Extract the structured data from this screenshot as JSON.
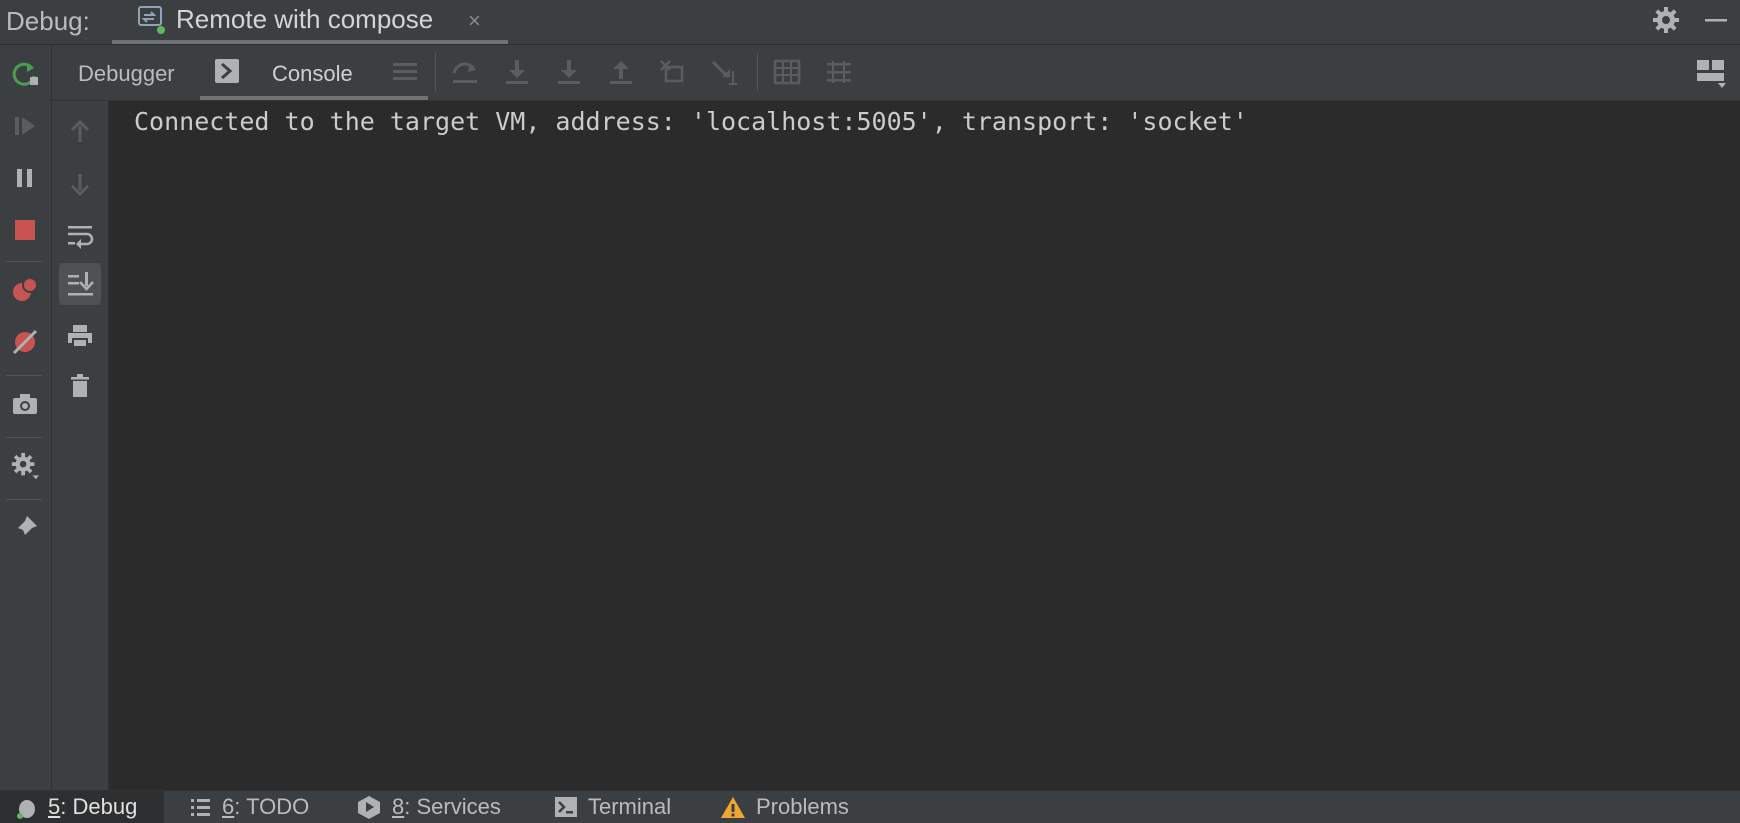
{
  "title_bar": {
    "label": "Debug:",
    "run_tab": {
      "title": "Remote with compose",
      "close": "×"
    }
  },
  "tabs": {
    "debugger": "Debugger",
    "console": "Console"
  },
  "console": {
    "lines": [
      "Connected to the target VM, address: 'localhost:5005', transport: 'socket'"
    ]
  },
  "bottom_bar": {
    "items": [
      {
        "mnemonic": "5",
        "label": ": Debug"
      },
      {
        "mnemonic": "6",
        "label": ": TODO"
      },
      {
        "mnemonic": "8",
        "label": ": Services"
      },
      {
        "mnemonic": "",
        "label": "Terminal"
      },
      {
        "mnemonic": "",
        "label": "Problems"
      }
    ]
  },
  "icons": {
    "left_toolbar": [
      "rerun-icon",
      "resume-icon",
      "pause-icon",
      "stop-icon",
      "view-breakpoints-icon",
      "mute-breakpoints-icon",
      "camera-icon",
      "settings-icon",
      "pin-icon"
    ],
    "console_toolbar": [
      "up-arrow-icon",
      "down-arrow-icon",
      "soft-wrap-icon",
      "scroll-to-end-icon",
      "print-icon",
      "clear-all-icon"
    ]
  },
  "colors": {
    "background": "#2b2b2b",
    "panel": "#3c3f41",
    "text": "#bbbbbb",
    "stop_red": "#c75450",
    "rerun_green": "#499c54",
    "warning_yellow": "#f0a732"
  }
}
